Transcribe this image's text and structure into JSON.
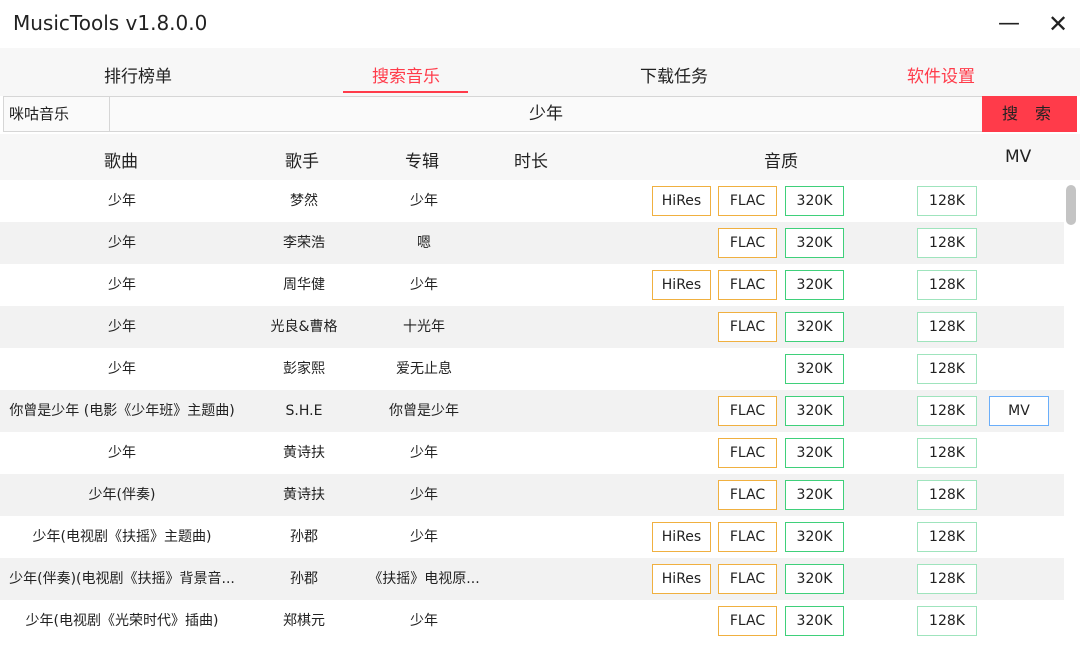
{
  "window": {
    "title": "MusicTools v1.8.0.0",
    "minimize_icon": "—",
    "close_icon": "✕"
  },
  "tabs": [
    {
      "label": "排行榜单"
    },
    {
      "label": "搜索音乐",
      "active": true
    },
    {
      "label": "下载任务"
    },
    {
      "label": "软件设置"
    }
  ],
  "search": {
    "source": "咪咕音乐",
    "query": "少年",
    "button": "搜 索"
  },
  "columns": {
    "song": "歌曲",
    "singer": "歌手",
    "album": "专辑",
    "duration": "时长",
    "quality": "音质",
    "mv": "MV"
  },
  "colors": {
    "accent": "#ff3b4a",
    "hires_border": "#f0b040",
    "flac_border": "#f0b040",
    "k320_border": "#3fd07a",
    "k128_border": "#9fe4bd",
    "mv_border": "#6aaefa"
  },
  "rows": [
    {
      "song": "少年",
      "singer": "梦然",
      "album": "少年",
      "hires": "HiRes",
      "flac": "FLAC",
      "k320": "320K",
      "k128": "128K"
    },
    {
      "song": "少年",
      "singer": "李荣浩",
      "album": "嗯",
      "flac": "FLAC",
      "k320": "320K",
      "k128": "128K"
    },
    {
      "song": "少年",
      "singer": "周华健",
      "album": "少年",
      "hires": "HiRes",
      "flac": "FLAC",
      "k320": "320K",
      "k128": "128K"
    },
    {
      "song": "少年",
      "singer": "光良&曹格",
      "album": "十光年",
      "flac": "FLAC",
      "k320": "320K",
      "k128": "128K"
    },
    {
      "song": "少年",
      "singer": "彭家熙",
      "album": "爱无止息",
      "k320": "320K",
      "k128": "128K"
    },
    {
      "song": "你曾是少年 (电影《少年班》主题曲)",
      "singer": "S.H.E",
      "album": "你曾是少年",
      "flac": "FLAC",
      "k320": "320K",
      "k128": "128K",
      "mv": "MV"
    },
    {
      "song": "少年",
      "singer": "黄诗扶",
      "album": "少年",
      "flac": "FLAC",
      "k320": "320K",
      "k128": "128K"
    },
    {
      "song": "少年(伴奏)",
      "singer": "黄诗扶",
      "album": "少年",
      "flac": "FLAC",
      "k320": "320K",
      "k128": "128K"
    },
    {
      "song": "少年(电视剧《扶摇》主题曲)",
      "singer": "孙郡",
      "album": "少年",
      "hires": "HiRes",
      "flac": "FLAC",
      "k320": "320K",
      "k128": "128K"
    },
    {
      "song": "少年(伴奏)(电视剧《扶摇》背景音...",
      "singer": "孙郡",
      "album": "《扶摇》电视原...",
      "hires": "HiRes",
      "flac": "FLAC",
      "k320": "320K",
      "k128": "128K"
    },
    {
      "song": "少年(电视剧《光荣时代》插曲)",
      "singer": "郑棋元",
      "album": "少年",
      "flac": "FLAC",
      "k320": "320K",
      "k128": "128K"
    }
  ]
}
